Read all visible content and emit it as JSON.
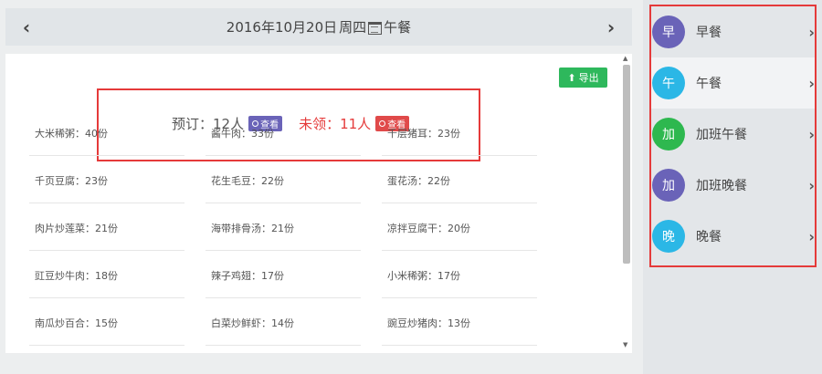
{
  "header": {
    "date": "2016年10月20日",
    "weekday": "周四",
    "meal": "午餐",
    "prev_icon": "chevron-left-icon",
    "next_icon": "chevron-right-icon"
  },
  "summary": {
    "ordered_label": "预订：12人",
    "unclaimed_label": "未领：11人",
    "view_label": "查看",
    "colors": {
      "ordered_btn": "#6a63b8",
      "unclaimed": "#e53a3a",
      "unclaimed_btn": "#e04a4a"
    }
  },
  "toolbar": {
    "export_label": "导出",
    "export_color": "#2eb85c"
  },
  "dishes": [
    "大米稀粥：40份",
    "酱牛肉：33份",
    "千层猪耳：23份",
    "千页豆腐：23份",
    "花生毛豆：22份",
    "蛋花汤：22份",
    "肉片炒莲菜：21份",
    "海带排骨汤：21份",
    "凉拌豆腐干：20份",
    "豇豆炒牛肉：18份",
    "辣子鸡翅：17份",
    "小米稀粥：17份",
    "南瓜炒百合：15份",
    "白菜炒鲜虾：14份",
    "豌豆炒猪肉：13份"
  ],
  "meals": [
    {
      "badge": "早",
      "label": "早餐",
      "color": "#6a63b8"
    },
    {
      "badge": "午",
      "label": "午餐",
      "color": "#2bb7e6"
    },
    {
      "badge": "加",
      "label": "加班午餐",
      "color": "#2eb84f"
    },
    {
      "badge": "加",
      "label": "加班晚餐",
      "color": "#6a63b8"
    },
    {
      "badge": "晚",
      "label": "晚餐",
      "color": "#2bb7e6"
    }
  ]
}
